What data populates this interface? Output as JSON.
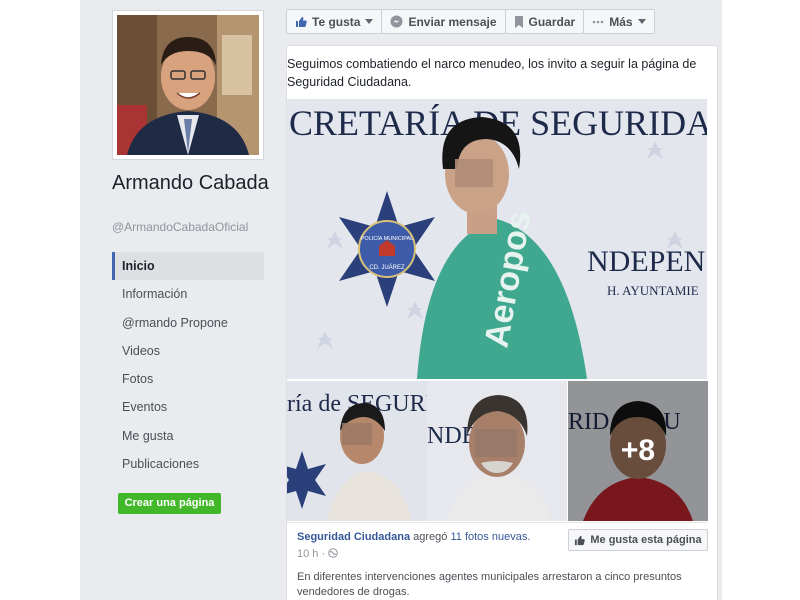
{
  "profile": {
    "name": "Armando Cabada",
    "handle": "@ArmandoCabadaOficial"
  },
  "nav": {
    "items": [
      {
        "label": "Inicio",
        "active": true
      },
      {
        "label": "Información"
      },
      {
        "label": "@rmando Propone"
      },
      {
        "label": "Videos"
      },
      {
        "label": "Fotos"
      },
      {
        "label": "Eventos"
      },
      {
        "label": "Me gusta"
      },
      {
        "label": "Publicaciones"
      }
    ],
    "create_page_label": "Crear una página"
  },
  "action_bar": {
    "like_label": "Te gusta",
    "message_label": "Enviar mensaje",
    "save_label": "Guardar",
    "more_label": "Más"
  },
  "post": {
    "text": "Seguimos combatiendo el narco menudeo, los invito a seguir la página de Seguridad Ciudadana.",
    "main_image": {
      "backdrop_text": "CRETARÍA DE SEGURIDAD",
      "backdrop_text_2": "NDEPEN",
      "backdrop_text_3": "H. AYUNTAMIE",
      "badge_line1": "POLICÍA MUNICIPAL",
      "badge_line2": "CD. JUÁREZ",
      "shirt_text": "Aeropos"
    },
    "thumbnails": [
      {
        "backdrop_text": "ría de SEGURID"
      },
      {
        "backdrop_text": "NDEPEN"
      },
      {
        "backdrop_text": "RIDAD PU",
        "more_count": "+8"
      }
    ],
    "shared": {
      "page_name": "Seguridad Ciudadana",
      "action_text": "agregó",
      "photos_text": "11 fotos nuevas.",
      "time": "10 h ·",
      "like_page_label": "Me gusta esta página",
      "description": "En diferentes intervenciones agentes municipales arrestaron a cinco presuntos vendedores de drogas."
    }
  }
}
